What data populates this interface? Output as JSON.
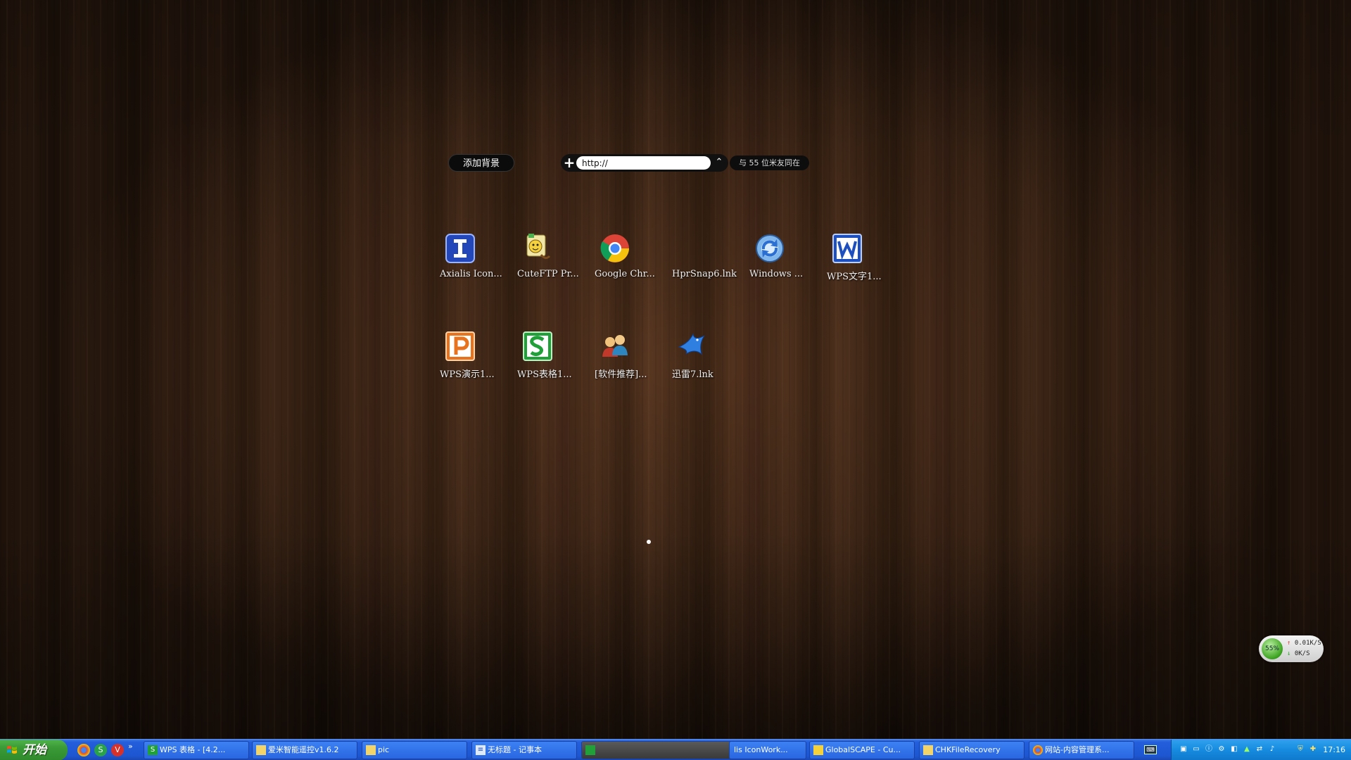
{
  "topbar": {
    "add_background_label": "添加背景",
    "url_placeholder": "http://",
    "online_badge": "与 55 位米友同在"
  },
  "desktop_icons": [
    {
      "label": "Axialis Icon...",
      "icon": "axialis-icon"
    },
    {
      "label": "CuteFTP Pr...",
      "icon": "cuteftp-icon"
    },
    {
      "label": "Google Chr...",
      "icon": "chrome-icon"
    },
    {
      "label": "HprSnap6.lnk",
      "icon": "hprsnap-icon"
    },
    {
      "label": "Windows ...",
      "icon": "windows-update-icon"
    },
    {
      "label": "WPS文字1...",
      "icon": "wps-writer-icon"
    },
    {
      "label": "WPS演示1...",
      "icon": "wps-presentation-icon"
    },
    {
      "label": "WPS表格1...",
      "icon": "wps-spreadsheet-icon"
    },
    {
      "label": "[软件推荐]...",
      "icon": "software-recommend-icon"
    },
    {
      "label": "迅雷7.lnk",
      "icon": "thunder-icon"
    }
  ],
  "net_widget": {
    "percent": "55%",
    "up": "0.01K/S",
    "down": "0K/S"
  },
  "taskbar": {
    "start_label": "开始",
    "quick_launch_more": "»",
    "tasks": [
      {
        "label": "WPS 表格 - [4.2...",
        "icon": "wps-spreadsheet-icon"
      },
      {
        "label": "爱米智能遥控v1.6.2",
        "icon": "folder-icon"
      },
      {
        "label": "pic",
        "icon": "folder-icon"
      },
      {
        "label": "无标题 - 记事本",
        "icon": "notepad-icon"
      },
      {
        "label": "",
        "icon": "app-icon"
      },
      {
        "label": "lis IconWork...",
        "icon": ""
      },
      {
        "label": "GlobalSCAPE - Cu...",
        "icon": "cuteftp-icon"
      },
      {
        "label": "CHKFileRecovery",
        "icon": "folder-icon"
      },
      {
        "label": "网站-内容管理系...",
        "icon": "chrome-icon"
      }
    ],
    "clock": "17:16"
  },
  "colors": {
    "taskbar_blue": "#245edb",
    "start_green": "#3a9a36",
    "tray_blue": "#168bdf"
  }
}
